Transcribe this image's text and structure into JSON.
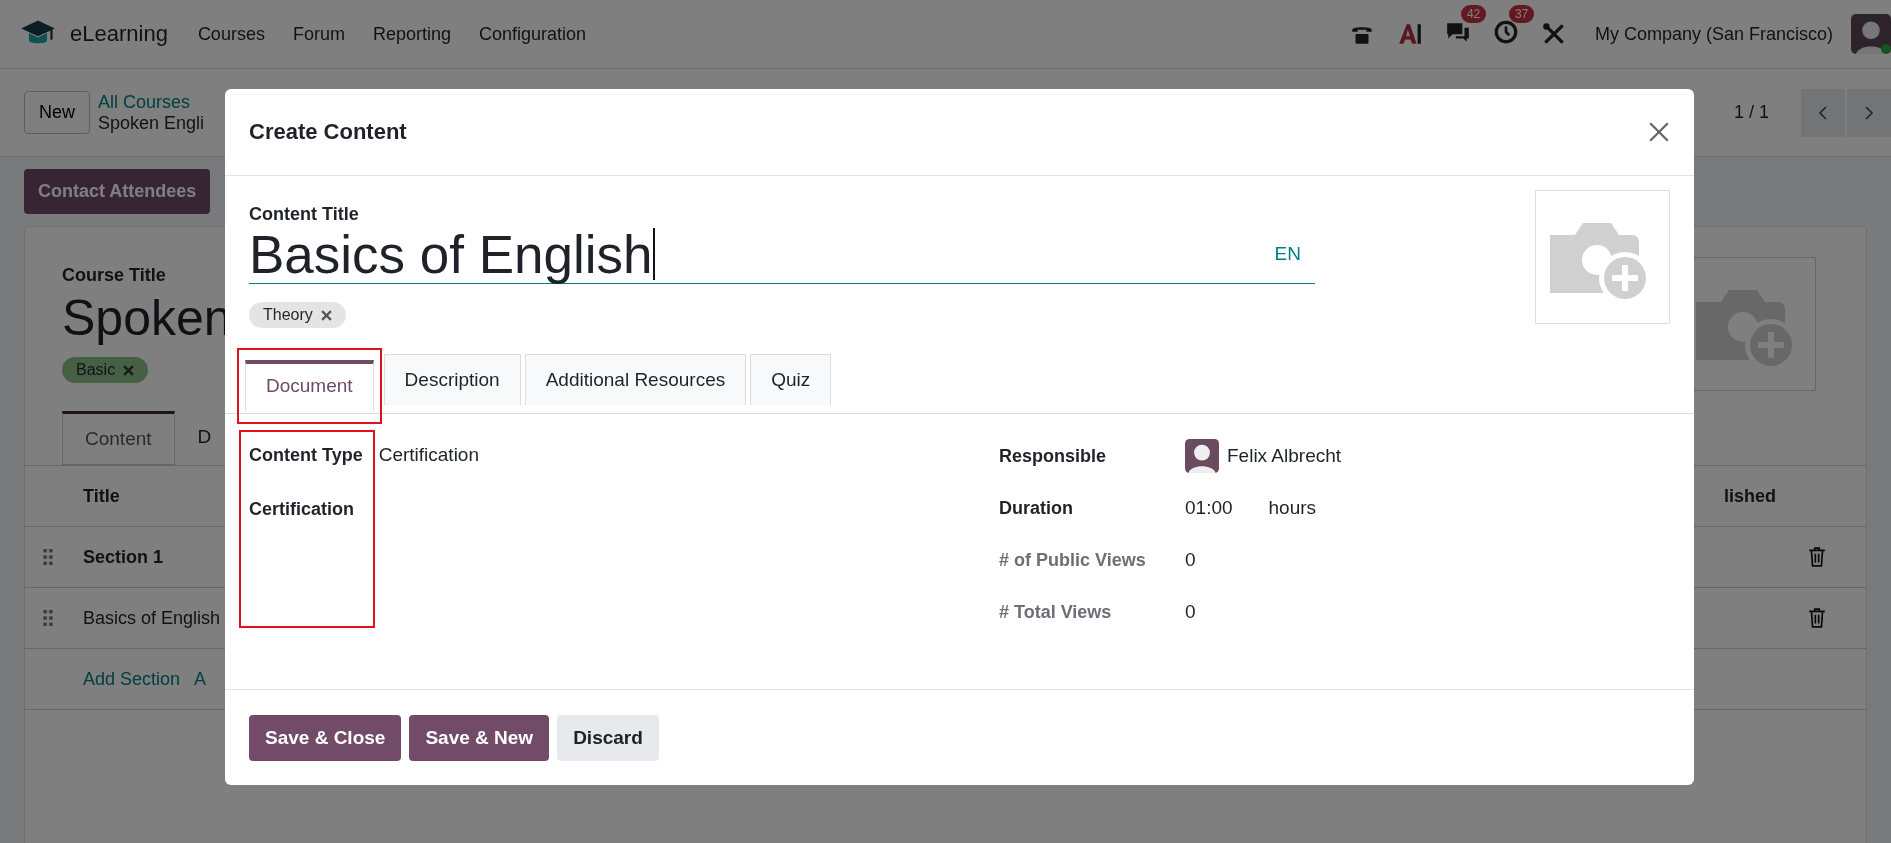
{
  "app": {
    "name": "eLearning",
    "menu": [
      "Courses",
      "Forum",
      "Reporting",
      "Configuration"
    ]
  },
  "systray": {
    "chat_count": "42",
    "activity_count": "37",
    "company": "My Company (San Francisco)"
  },
  "control_panel": {
    "new_button": "New",
    "breadcrumb": "All Courses",
    "record": "Spoken Engli",
    "pager": "1 / 1"
  },
  "action_button": "Contact Attendees",
  "course": {
    "title_label": "Course Title",
    "title": "Spoken",
    "tags": [
      "Basic"
    ],
    "tabs": [
      {
        "label": "Content",
        "selected": true
      },
      {
        "label": "D",
        "selected": false
      }
    ],
    "columns": [
      "Title",
      "lished"
    ],
    "rows": [
      {
        "title": "Section 1",
        "kind": "section"
      },
      {
        "title": "Basics of English",
        "kind": "content"
      }
    ],
    "add_links": [
      "Add Section",
      "A"
    ]
  },
  "dialog": {
    "title": "Create Content",
    "title_label": "Content Title",
    "content_title": "Basics of English",
    "language": "EN",
    "tags": [
      "Theory"
    ],
    "tabs": [
      {
        "label": "Document",
        "selected": true,
        "highlighted": true
      },
      {
        "label": "Description",
        "selected": false,
        "highlighted": false
      },
      {
        "label": "Additional Resources",
        "selected": false,
        "highlighted": false
      },
      {
        "label": "Quiz",
        "selected": false,
        "highlighted": false
      }
    ],
    "left_fields": {
      "highlighted": true,
      "items": [
        {
          "label": "Content Type",
          "value": "Certification"
        },
        {
          "label": "Certification"
        }
      ]
    },
    "right_fields": [
      {
        "label": "Responsible",
        "value": "Felix Albrecht",
        "kind": "user"
      },
      {
        "label": "Duration",
        "value": "01:00",
        "unit": "hours",
        "kind": "duration"
      },
      {
        "label": "# of Public Views",
        "value": "0",
        "kind": "readonly"
      },
      {
        "label": "# Total Views",
        "value": "0",
        "kind": "readonly"
      }
    ],
    "buttons": [
      {
        "label": "Save & Close",
        "kind": "primary"
      },
      {
        "label": "Save & New",
        "kind": "primary"
      },
      {
        "label": "Discard",
        "kind": "secondary"
      }
    ]
  }
}
